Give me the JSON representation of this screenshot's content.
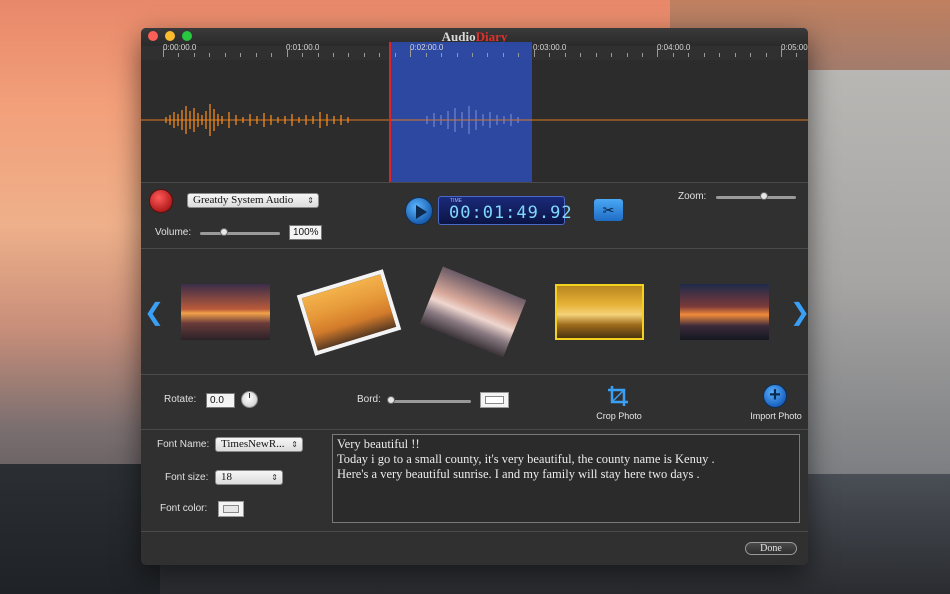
{
  "window": {
    "title_part1": "Audio",
    "title_part2": "Diary"
  },
  "timeline": {
    "ticks": [
      "0:00:00.0",
      "0:01:00.0",
      "0:02:00.0",
      "0:03:00.0",
      "0:04:00.0",
      "0:05:00.0"
    ]
  },
  "audio": {
    "source_select": "Greatdy System Audio",
    "volume_label": "Volume:",
    "volume_value": "100%",
    "volume_level": 0.3,
    "zoom_label": "Zoom:",
    "zoom_level": 0.6,
    "time_caption": "TIME",
    "time_display": "00:01:49.92"
  },
  "photos": [
    {
      "name": "sunset-cliff"
    },
    {
      "name": "tower-sunset"
    },
    {
      "name": "rocky-shore"
    },
    {
      "name": "palm-beach"
    },
    {
      "name": "coast-sunset"
    }
  ],
  "photo_tools": {
    "rotate_label": "Rotate:",
    "rotate_value": "0.0",
    "bord_label": "Bord:",
    "bord_level": 0.0,
    "crop_label": "Crop Photo",
    "import_label": "Import Photo"
  },
  "font_settings": {
    "font_name_label": "Font Name:",
    "font_name_value": "TimesNewR...",
    "font_size_label": "Font size:",
    "font_size_value": "18",
    "font_color_label": "Font color:"
  },
  "editor": {
    "line1": "Very beautiful !!",
    "line2": "Today i go to a small county, it's very beautiful,  the county name is Kenuy .",
    "line3": "Here's a very beautiful sunrise.  I  and my family will stay here  two days ."
  },
  "buttons": {
    "done": "Done"
  }
}
